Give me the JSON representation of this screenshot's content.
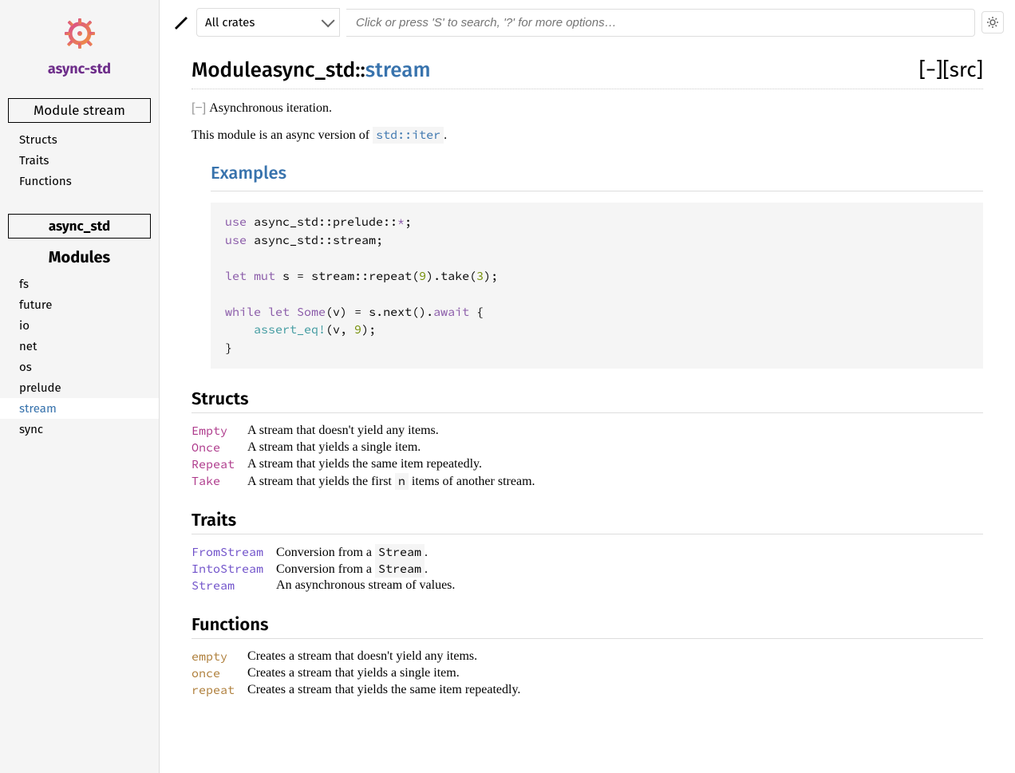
{
  "logo_text": "async-std",
  "sidebar": {
    "heading": "Module stream",
    "sections": [
      "Structs",
      "Traits",
      "Functions"
    ],
    "crate_heading": "async_std",
    "modules_title": "Modules",
    "modules": [
      "fs",
      "future",
      "io",
      "net",
      "os",
      "prelude",
      "stream",
      "sync"
    ],
    "active_module": "stream"
  },
  "topbar": {
    "crate_select": "All crates",
    "search_placeholder": "Click or press 'S' to search, '?' for more options…"
  },
  "title": {
    "prefix": "Module ",
    "path": "async_std::",
    "last": "stream",
    "collapse": "[−]",
    "src": "[src]"
  },
  "doc": {
    "toggle": "[−]",
    "summary": "Asynchronous iteration.",
    "desc_pre": "This module is an async version of ",
    "desc_code": "std::iter",
    "desc_post": ".",
    "examples_heading": "Examples"
  },
  "headings": {
    "structs": "Structs",
    "traits": "Traits",
    "functions": "Functions"
  },
  "structs": [
    {
      "name": "Empty",
      "desc": "A stream that doesn't yield any items."
    },
    {
      "name": "Once",
      "desc": "A stream that yields a single item."
    },
    {
      "name": "Repeat",
      "desc": "A stream that yields the same item repeatedly."
    },
    {
      "name": "Take",
      "desc_pre": "A stream that yields the first ",
      "code": "n",
      "desc_post": " items of another stream."
    }
  ],
  "traits": [
    {
      "name": "FromStream",
      "desc_pre": "Conversion from a ",
      "code": "Stream",
      "desc_post": "."
    },
    {
      "name": "IntoStream",
      "desc_pre": "Conversion from a ",
      "code": "Stream",
      "desc_post": "."
    },
    {
      "name": "Stream",
      "desc": "An asynchronous stream of values."
    }
  ],
  "functions": [
    {
      "name": "empty",
      "desc": "Creates a stream that doesn't yield any items."
    },
    {
      "name": "once",
      "desc": "Creates a stream that yields a single item."
    },
    {
      "name": "repeat",
      "desc": "Creates a stream that yields the same item repeatedly."
    }
  ],
  "code_example": {
    "lines": [
      {
        "t": "use ",
        "c": "kw"
      },
      {
        "t": "async_std::prelude::"
      },
      {
        "t": "*",
        "c": "op"
      },
      {
        "t": ";\n"
      },
      {
        "t": "use ",
        "c": "kw"
      },
      {
        "t": "async_std::stream;\n\n"
      },
      {
        "t": "let ",
        "c": "kw"
      },
      {
        "t": "mut ",
        "c": "kw"
      },
      {
        "t": "s "
      },
      {
        "t": "= ",
        "c": ""
      },
      {
        "t": "stream::repeat("
      },
      {
        "t": "9",
        "c": "num"
      },
      {
        "t": ").take("
      },
      {
        "t": "3",
        "c": "num"
      },
      {
        "t": ");\n\n"
      },
      {
        "t": "while ",
        "c": "kw"
      },
      {
        "t": "let ",
        "c": "kw"
      },
      {
        "t": "Some",
        "c": "op"
      },
      {
        "t": "(v) "
      },
      {
        "t": "= ",
        "c": ""
      },
      {
        "t": "s.next()."
      },
      {
        "t": "await",
        "c": "kw"
      },
      {
        "t": " {\n    "
      },
      {
        "t": "assert_eq!",
        "c": "macro"
      },
      {
        "t": "(v, "
      },
      {
        "t": "9",
        "c": "num"
      },
      {
        "t": ");\n}"
      }
    ]
  }
}
